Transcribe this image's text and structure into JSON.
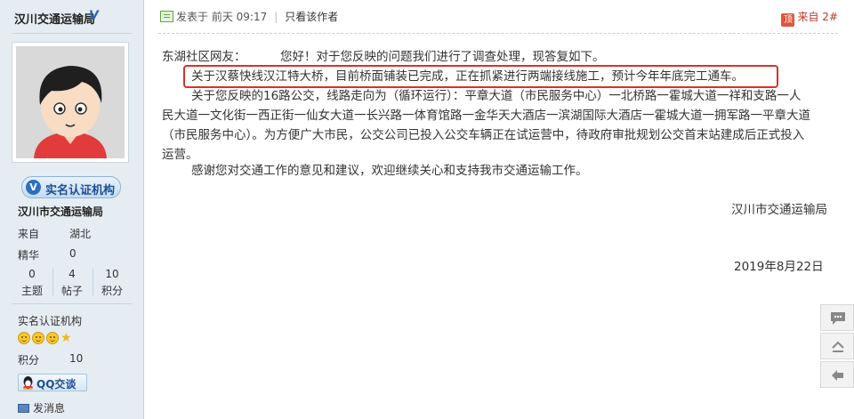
{
  "sidebar": {
    "username": "汉川交通运输局",
    "verified_mark": "V",
    "cert_badge": "实名认证机构",
    "org_name": "汉川市交通运输局",
    "from_label": "来自",
    "from_value": "湖北",
    "jinghua_label": "精华",
    "jinghua_value": "0",
    "stats": [
      {
        "num": "0",
        "label": "主题"
      },
      {
        "num": "4",
        "label": "帖子"
      },
      {
        "num": "10",
        "label": "积分"
      }
    ],
    "group_label": "实名认证机构",
    "rank_icons": [
      "smiley-icon",
      "smiley-icon",
      "smiley-icon",
      "star-icon"
    ],
    "points_label": "积分",
    "points_value": "10",
    "qq_button": "QQ交谈",
    "message_link": "发消息"
  },
  "post_header": {
    "posted_prefix": "发表于",
    "posted_time": "前天 09:17",
    "separator": "|",
    "only_author": "只看该作者",
    "top_icon": "顶",
    "floor": "来自 2#"
  },
  "post_body": {
    "greeting": "东湖社区网友：",
    "greeting_text": "您好！对于您反映的问题我们进行了调查处理，现答复如下。",
    "highlight": "关于汉蔡快线汉江特大桥，目前桥面铺装已完成，正在抓紧进行两端接线施工，预计今年年底完工通车。",
    "para2_line1": "关于您反映的16路公交，线路走向为（循环运行）：平章大道（市民服务中心）一北桥路一霍城大道一祥和支路一人",
    "para2_line2": "民大道一文化街一西正街一仙女大道一长兴路一体育馆路一金华天大酒店一滨湖国际大酒店一霍城大道一拥军路一平章大道",
    "para2_line3": "（市民服务中心）。为方便广大市民，公交公司已投入公交车辆正在试运营中，待政府审批规划公交首末站建成后正式投入",
    "para2_line4": "运营。",
    "thanks": "感谢您对交通工作的意见和建议，欢迎继续关心和支持我市交通运输工作。",
    "signature": "汉川市交通运输局",
    "date": "2019年8月22日"
  },
  "float_tools": [
    "comment-icon",
    "back-to-top-icon",
    "return-list-icon"
  ],
  "colors": {
    "highlight_border": "#d9302c",
    "sidebar_bg": "#e5edf2",
    "link_blue": "#1d4f97"
  }
}
